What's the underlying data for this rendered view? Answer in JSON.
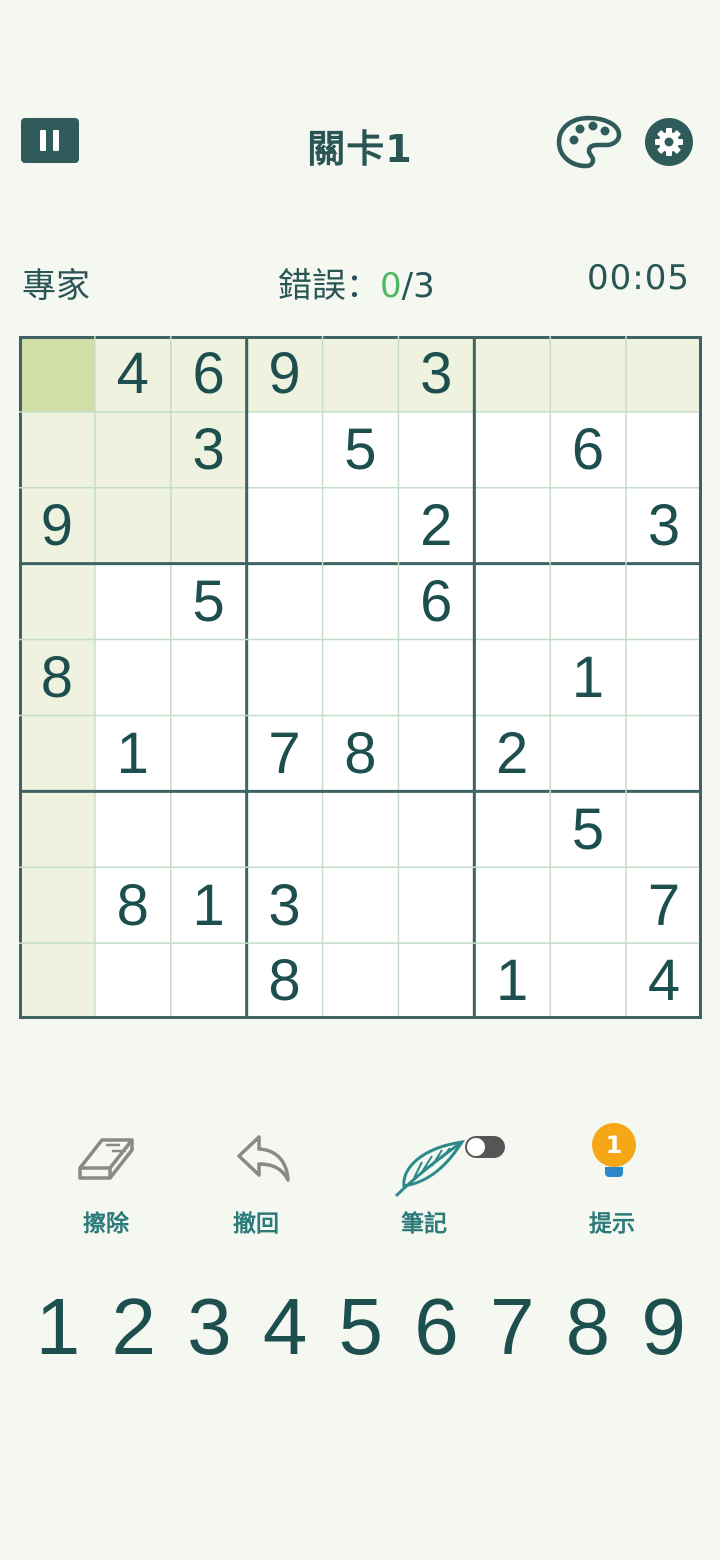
{
  "header": {
    "title": "關卡1"
  },
  "status": {
    "difficulty": "專家",
    "mistakes_label": "錯誤：",
    "mistakes_current": "0",
    "mistakes_sep_max": "/3",
    "timer": "00:05"
  },
  "board": {
    "grid": [
      [
        "",
        "4",
        "6",
        "9",
        "",
        "3",
        "",
        "",
        ""
      ],
      [
        "",
        "",
        "3",
        "",
        "5",
        "",
        "",
        "6",
        ""
      ],
      [
        "9",
        "",
        "",
        "",
        "",
        "2",
        "",
        "",
        "3"
      ],
      [
        "",
        "",
        "5",
        "",
        "",
        "6",
        "",
        "",
        ""
      ],
      [
        "8",
        "",
        "",
        "",
        "",
        "",
        "",
        "1",
        ""
      ],
      [
        "",
        "1",
        "",
        "7",
        "8",
        "",
        "2",
        "",
        ""
      ],
      [
        "",
        "",
        "",
        "",
        "",
        "",
        "",
        "5",
        ""
      ],
      [
        "",
        "8",
        "1",
        "3",
        "",
        "",
        "",
        "",
        "7"
      ],
      [
        "",
        "",
        "",
        "8",
        "",
        "",
        "1",
        "",
        "4"
      ]
    ],
    "selected": [
      0,
      0
    ],
    "colors": {
      "selected": "#d1dfa7",
      "highlight": "#eef2df",
      "empty": "#ffffff",
      "thin_line": "#c5dcc8",
      "thick_line": "#3f6262"
    }
  },
  "tools": {
    "erase_label": "擦除",
    "undo_label": "撤回",
    "notes_label": "筆記",
    "hint_label": "提示",
    "hint_count": "1",
    "notes_on": false
  },
  "numpad": [
    "1",
    "2",
    "3",
    "4",
    "5",
    "6",
    "7",
    "8",
    "9"
  ]
}
